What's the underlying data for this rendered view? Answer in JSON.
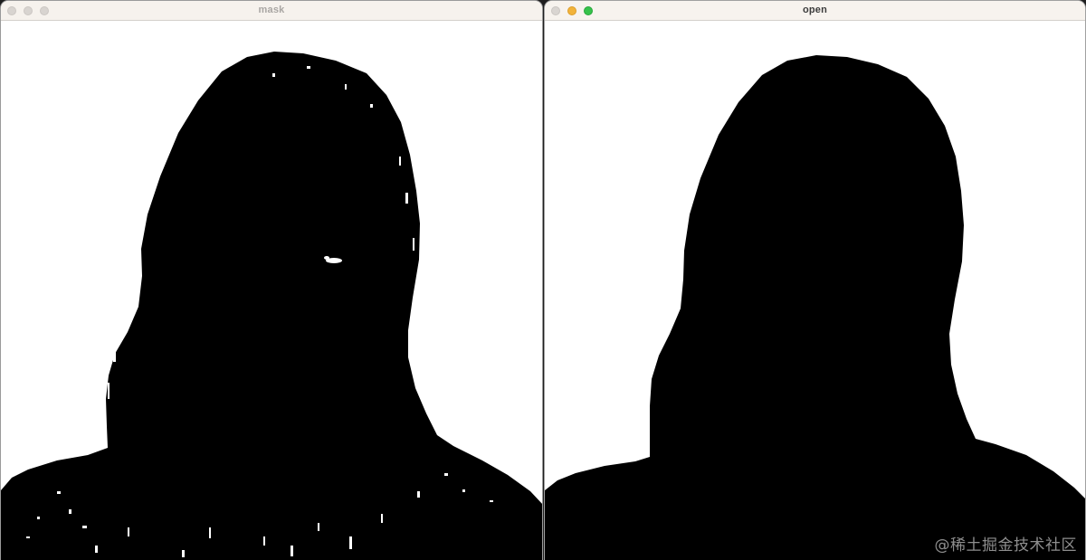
{
  "windows": [
    {
      "title": "mask",
      "state": "inactive",
      "buttons": [
        "close-button",
        "minimize-button",
        "zoom-button"
      ]
    },
    {
      "title": "open",
      "state": "active",
      "buttons": [
        "close-button",
        "minimize-button",
        "zoom-button"
      ]
    }
  ],
  "watermark": "@稀土掘金技术社区",
  "colors": {
    "titlebar": "#f6f2ed",
    "silhouette": "#000000",
    "background": "#ffffff",
    "minimize": "#f2b33a",
    "zoom": "#36c24b"
  }
}
